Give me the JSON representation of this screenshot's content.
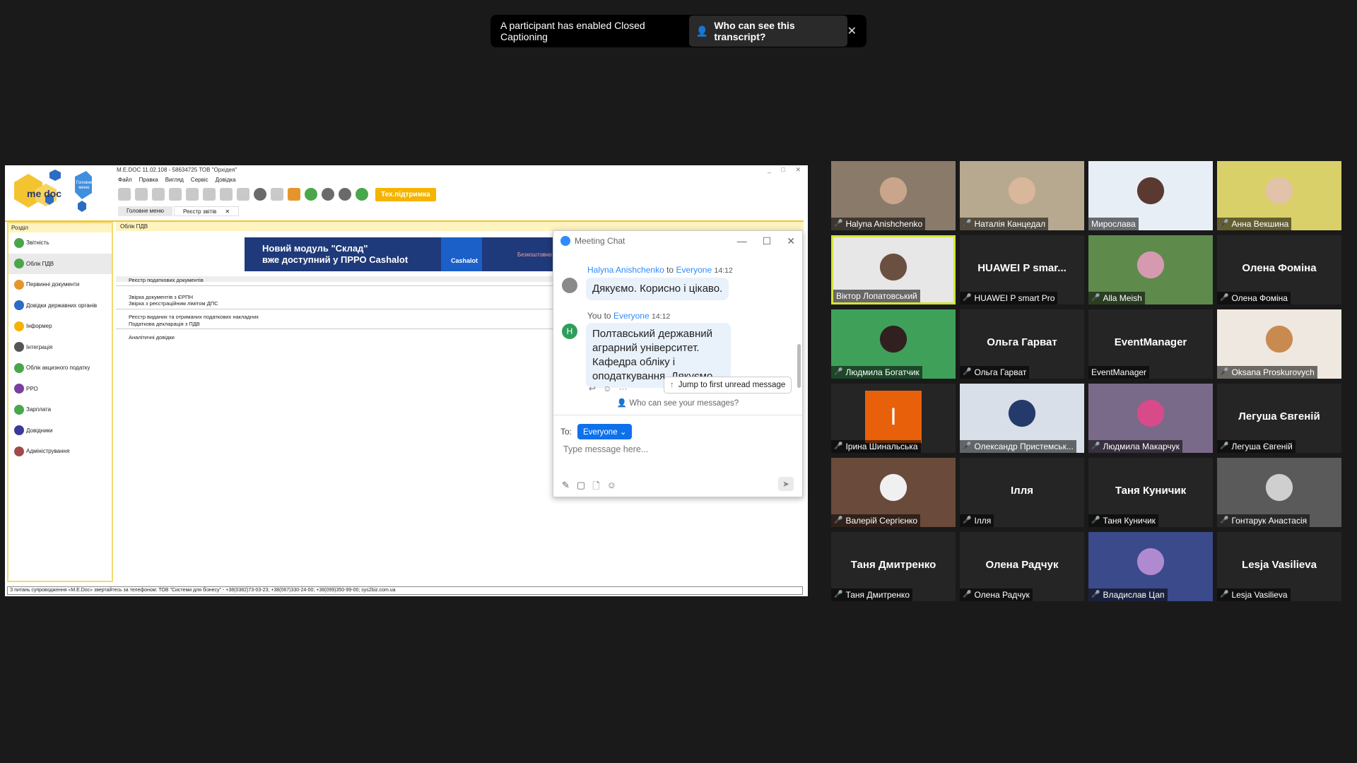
{
  "cc_banner": {
    "text": "A participant has enabled Closed Captioning",
    "button": "Who can see this transcript?",
    "close": "✕"
  },
  "medoc": {
    "title": "M.E.DOC 11.02.108 - 58634725 ТОВ \"Орхідея\"",
    "menu": [
      "Файл",
      "Правка",
      "Вигляд",
      "Сервіс",
      "Довідка"
    ],
    "logo_text": "me doc",
    "logo_sub": "Головне меню",
    "tech_support": "Тех.підтримка",
    "tabs": [
      "Головне меню",
      "Реєстр звітів"
    ],
    "tab_close": "✕",
    "sidebar_header": "Розділ",
    "sidebar": [
      {
        "label": "Звітність",
        "color": "#4aa64a"
      },
      {
        "label": "Облік ПДВ",
        "color": "#4aa64a"
      },
      {
        "label": "Первинні документи",
        "color": "#e6952a"
      },
      {
        "label": "Довідки державних органів",
        "color": "#2b6cc4"
      },
      {
        "label": "Інформер",
        "color": "#f4b400"
      },
      {
        "label": "Інтеграція",
        "color": "#555555"
      },
      {
        "label": "Облік акцизного податку",
        "color": "#4aa64a"
      },
      {
        "label": "РРО",
        "color": "#7a3fa0"
      },
      {
        "label": "Зарплата",
        "color": "#4aa64a"
      },
      {
        "label": "Довідники",
        "color": "#3a3a9a"
      },
      {
        "label": "Адміністрування",
        "color": "#a04a4a"
      }
    ],
    "main_header": "Облік ПДВ",
    "banner_line1": "Новий модуль \"Склад\"",
    "banner_line2": "вже доступний у ПРРО Cashalot",
    "banner_brand": "Cashalot",
    "banner_free": "Безкоштовно",
    "docs": [
      "Реєстр податкових документів",
      "Звірка документів з ЄРПН",
      "Звірка з реєстраційним лімітом ДПС",
      "Реєстр виданих та отриманих податкових накладних",
      "Податкова декларація з ПДВ",
      "Аналітичні довідки"
    ],
    "status": "З питань супроводження «M.E.Doc» звертайтесь за телефоном: ТОВ \"Системи для бізнесу\" - +38(0382)73-03-23; +38(067)330-24-00; +38(099)350-99-00; sys2biz.com.ua"
  },
  "chat": {
    "title": "Meeting Chat",
    "msg1_from": "Halyna Anishchenko",
    "msg1_to_word": "to",
    "msg1_to": "Everyone",
    "msg1_time": "14:12",
    "msg1_text": "Дякуємо. Корисно і цікаво.",
    "msg2_from": "You to",
    "msg2_to": "Everyone",
    "msg2_time": "14:12",
    "msg2_avatar": "H",
    "msg2_text": "Полтавський державний аграрний університет. Кафедра обліку і оподаткування. Дякуємо.",
    "jump": "Jump to first unread message",
    "who_can_see": "Who can see your messages?",
    "to_label": "To:",
    "to_value": "Everyone",
    "placeholder": "Type message here...",
    "colors": {
      "accent": "#2d8cff",
      "bubble": "#e9f1fb",
      "avatar_you": "#2e9e5b"
    }
  },
  "gallery": [
    {
      "name": "Halyna Anishchenko",
      "muted": true,
      "video": true,
      "bg": "#8a7a6a",
      "face": "#c9a58c"
    },
    {
      "name": "Наталія Канцедал",
      "muted": true,
      "video": true,
      "bg": "#b7a98f",
      "face": "#d9b79a"
    },
    {
      "name": "Мирослава",
      "muted": false,
      "video": true,
      "bg": "#e8eef5",
      "face": "#5a3a30"
    },
    {
      "name": "Анна Векшина",
      "muted": true,
      "video": true,
      "bg": "#d9d06a",
      "face": "#e2c2a8"
    },
    {
      "name": "Віктор Лопатовський",
      "muted": false,
      "video": true,
      "active": true,
      "bg": "#e7e7e7",
      "face": "#6a5040"
    },
    {
      "name": "HUAWEI P smart Pro",
      "big": "HUAWEI P smar...",
      "muted": true,
      "video": false
    },
    {
      "name": "Alla Meish",
      "muted": true,
      "video": true,
      "bg": "#5e8a4c",
      "face": "#d69ab0"
    },
    {
      "name": "Олена Фоміна",
      "big": "Олена Фоміна",
      "muted": true,
      "video": false
    },
    {
      "name": "Людмила Богатчик",
      "muted": true,
      "video": true,
      "bg": "#3fa05a",
      "face": "#302020"
    },
    {
      "name": "Ольга Гарват",
      "big": "Ольга Гарват",
      "muted": true,
      "video": false
    },
    {
      "name": "EventManager",
      "big": "EventManager",
      "muted": false,
      "video": false
    },
    {
      "name": "Oksana Proskurovych",
      "muted": true,
      "video": true,
      "bg": "#efe8e0",
      "face": "#c98a50"
    },
    {
      "name": "Ірина Шинальська",
      "big": "I",
      "muted": true,
      "video": false,
      "orange": true
    },
    {
      "name": "Олександр Пристемськ...",
      "muted": true,
      "video": true,
      "bg": "#d8dfe8",
      "face": "#243a6a"
    },
    {
      "name": "Людмила Макарчук",
      "muted": true,
      "video": true,
      "bg": "#7a6a8a",
      "face": "#d94a8a"
    },
    {
      "name": "Легуша Євгеній",
      "big": "Легуша Євгеній",
      "muted": true,
      "video": false
    },
    {
      "name": "Валерій  Сергієнко",
      "muted": true,
      "video": true,
      "bg": "#6a4a3a",
      "face": "#f0f0f0"
    },
    {
      "name": "Ілля",
      "big": "Ілля",
      "muted": true,
      "video": false
    },
    {
      "name": "Таня Куничик",
      "big": "Таня Куничик",
      "muted": true,
      "video": false
    },
    {
      "name": "Гонтарук Анастасія",
      "muted": true,
      "video": true,
      "bg": "#5a5a5a",
      "face": "#cfcfcf"
    },
    {
      "name": "Таня Дмитренко",
      "big": "Таня Дмитренко",
      "muted": true,
      "video": false
    },
    {
      "name": "Олена Радчук",
      "big": "Олена Радчук",
      "muted": true,
      "video": false
    },
    {
      "name": "Владислав Цап",
      "muted": true,
      "video": true,
      "bg": "#3a4a8a",
      "face": "#b08ad0"
    },
    {
      "name": "Lesja Vasilieva",
      "big": "Lesja Vasilieva",
      "muted": true,
      "video": false
    }
  ]
}
